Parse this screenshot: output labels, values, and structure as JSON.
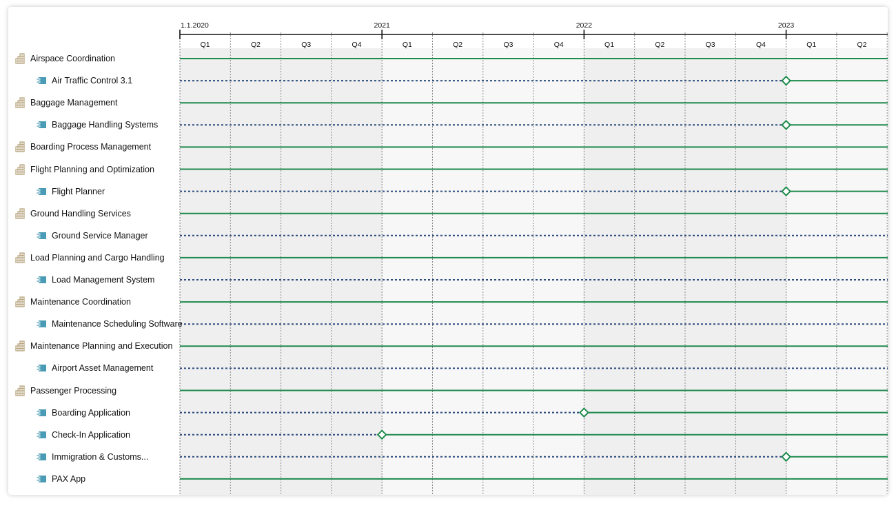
{
  "timeline": {
    "start_label": "1.1.2020",
    "years": [
      "2021",
      "2022",
      "2023"
    ],
    "quarters": [
      "Q1",
      "Q2",
      "Q3",
      "Q4",
      "Q1",
      "Q2",
      "Q3",
      "Q4",
      "Q1",
      "Q2",
      "Q3",
      "Q4",
      "Q1",
      "Q2"
    ]
  },
  "colors": {
    "active_line": "#1e8a4c",
    "planned_line": "#2c4a7c",
    "capability_icon": "#b7a47e",
    "application_icon": "#4a9bb5",
    "shade_dark": "#efefef",
    "shade_light": "#f7f7f7"
  },
  "rows": [
    {
      "label": "Airspace Coordination",
      "kind": "capability",
      "icon": "building-icon"
    },
    {
      "label": "Air Traffic Control 3.1",
      "kind": "application",
      "icon": "component-icon",
      "milestone": "Q1 2023"
    },
    {
      "label": "Baggage Management",
      "kind": "capability",
      "icon": "building-icon"
    },
    {
      "label": "Baggage Handling Systems",
      "kind": "application",
      "icon": "component-icon",
      "milestone": "Q1 2023"
    },
    {
      "label": "Boarding Process Management",
      "kind": "capability",
      "icon": "building-icon"
    },
    {
      "label": "Flight Planning and Optimization",
      "kind": "capability",
      "icon": "building-icon"
    },
    {
      "label": "Flight Planner",
      "kind": "application",
      "icon": "component-icon",
      "milestone": "Q1 2023"
    },
    {
      "label": "Ground Handling Services",
      "kind": "capability",
      "icon": "building-icon"
    },
    {
      "label": "Ground Service Manager",
      "kind": "application",
      "icon": "component-icon",
      "milestone": null
    },
    {
      "label": "Load Planning and Cargo Handling",
      "kind": "capability",
      "icon": "building-icon"
    },
    {
      "label": "Load Management System",
      "kind": "application",
      "icon": "component-icon",
      "milestone": null
    },
    {
      "label": "Maintenance Coordination",
      "kind": "capability",
      "icon": "building-icon"
    },
    {
      "label": "Maintenance Scheduling Software",
      "kind": "application",
      "icon": "component-icon",
      "milestone": null
    },
    {
      "label": "Maintenance Planning and Execution",
      "kind": "capability",
      "icon": "building-icon"
    },
    {
      "label": "Airport Asset Management",
      "kind": "application",
      "icon": "component-icon",
      "milestone": null
    },
    {
      "label": "Passenger Processing",
      "kind": "capability",
      "icon": "building-icon"
    },
    {
      "label": "Boarding Application",
      "kind": "application",
      "icon": "component-icon",
      "milestone": "Q1 2022"
    },
    {
      "label": "Check-In Application",
      "kind": "application",
      "icon": "component-icon",
      "milestone": "Q1 2021"
    },
    {
      "label": "Immigration & Customs...",
      "kind": "application",
      "icon": "component-icon",
      "milestone": "Q1 2023"
    },
    {
      "label": "PAX App",
      "kind": "application",
      "icon": "component-icon",
      "milestone": "always-active"
    }
  ]
}
